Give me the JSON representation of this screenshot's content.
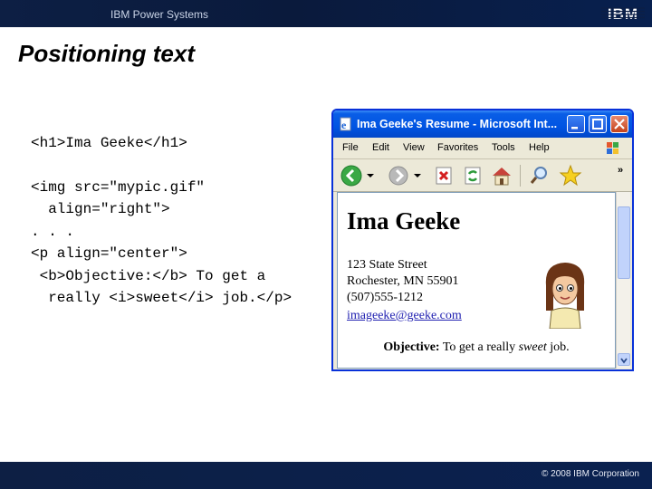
{
  "header": {
    "banner_title": "IBM Power Systems",
    "logo": "IBM"
  },
  "slide": {
    "title": "Positioning text"
  },
  "code": {
    "lines": [
      "<h1>Ima Geeke</h1>",
      "<img src=\"mypic.gif\"",
      "  align=\"right\">",
      ". . .",
      "<p align=\"center\">",
      " <b>Objective:</b> To get a",
      "  really <i>sweet</i> job.</p>"
    ]
  },
  "browser": {
    "title": "Ima Geeke's Resume - Microsoft Int...",
    "menu": [
      "File",
      "Edit",
      "View",
      "Favorites",
      "Tools",
      "Help"
    ],
    "toolbar_icons": [
      "back-icon",
      "forward-icon",
      "stop-icon",
      "refresh-icon",
      "home-icon",
      "search-icon",
      "favorites-star-icon"
    ],
    "page": {
      "heading": "Ima Geeke",
      "address": [
        "123 State Street",
        "Rochester, MN 55901",
        "(507)555-1212"
      ],
      "email": "imageeke@geeke.com",
      "objective_label": "Objective:",
      "objective_pre": "To get a really ",
      "objective_em": "sweet",
      "objective_post": " job."
    }
  },
  "footer": {
    "copyright": "© 2008 IBM Corporation"
  },
  "colors": {
    "banner": "#0d1f44",
    "xp_title": "#0054e3",
    "link": "#1f1fb0"
  }
}
